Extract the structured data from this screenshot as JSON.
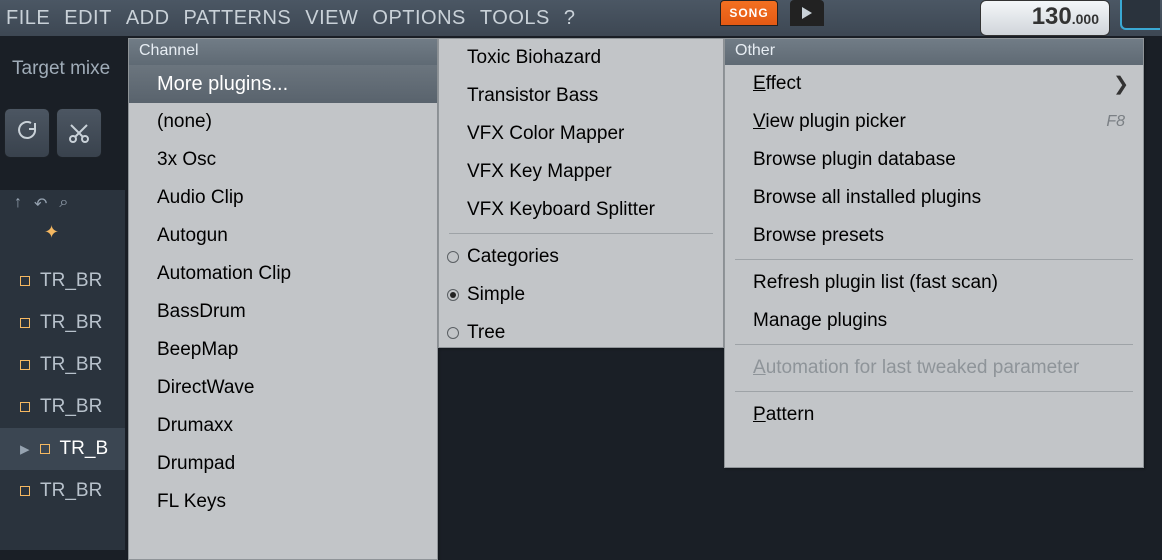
{
  "menubar": [
    "FILE",
    "EDIT",
    "ADD",
    "PATTERNS",
    "VIEW",
    "OPTIONS",
    "TOOLS",
    "?"
  ],
  "target_label": "Target mixe",
  "transport": {
    "song": "SONG",
    "tempo_int": "130",
    "tempo_frac": ".000"
  },
  "playlist_clips": [
    "TR_BR",
    "TR_BR",
    "TR_BR",
    "TR_BR",
    "TR_B",
    "TR_BR"
  ],
  "playlist_selected_index": 4,
  "panel_channel": {
    "header": "Channel",
    "highlight": "More plugins...",
    "items": [
      "(none)",
      "3x Osc",
      "Audio Clip",
      "Autogun",
      "Automation Clip",
      "BassDrum",
      "BeepMap",
      "DirectWave",
      "Drumaxx",
      "Drumpad",
      "FL Keys"
    ]
  },
  "panel_center": {
    "items_top": [
      "Toxic Biohazard",
      "Transistor Bass",
      "VFX Color Mapper",
      "VFX Key Mapper",
      "VFX Keyboard Splitter"
    ],
    "view_modes": [
      {
        "label": "Categories",
        "selected": false
      },
      {
        "label": "Simple",
        "selected": true
      },
      {
        "label": "Tree",
        "selected": false
      }
    ]
  },
  "panel_other": {
    "header": "Other",
    "group_a": [
      {
        "label": "Effect",
        "mnemonic": 0,
        "submenu": true
      },
      {
        "label": "View plugin picker",
        "mnemonic": 0,
        "shortcut": "F8"
      },
      {
        "label": "Browse plugin database"
      },
      {
        "label": "Browse all installed plugins"
      },
      {
        "label": "Browse presets"
      }
    ],
    "group_b": [
      {
        "label": "Refresh plugin list (fast scan)"
      },
      {
        "label": "Manage plugins"
      }
    ],
    "group_c": [
      {
        "label": "Automation for last tweaked parameter",
        "mnemonic": 0,
        "disabled": true
      }
    ],
    "group_d": [
      {
        "label": "Pattern",
        "mnemonic": 0
      }
    ]
  }
}
